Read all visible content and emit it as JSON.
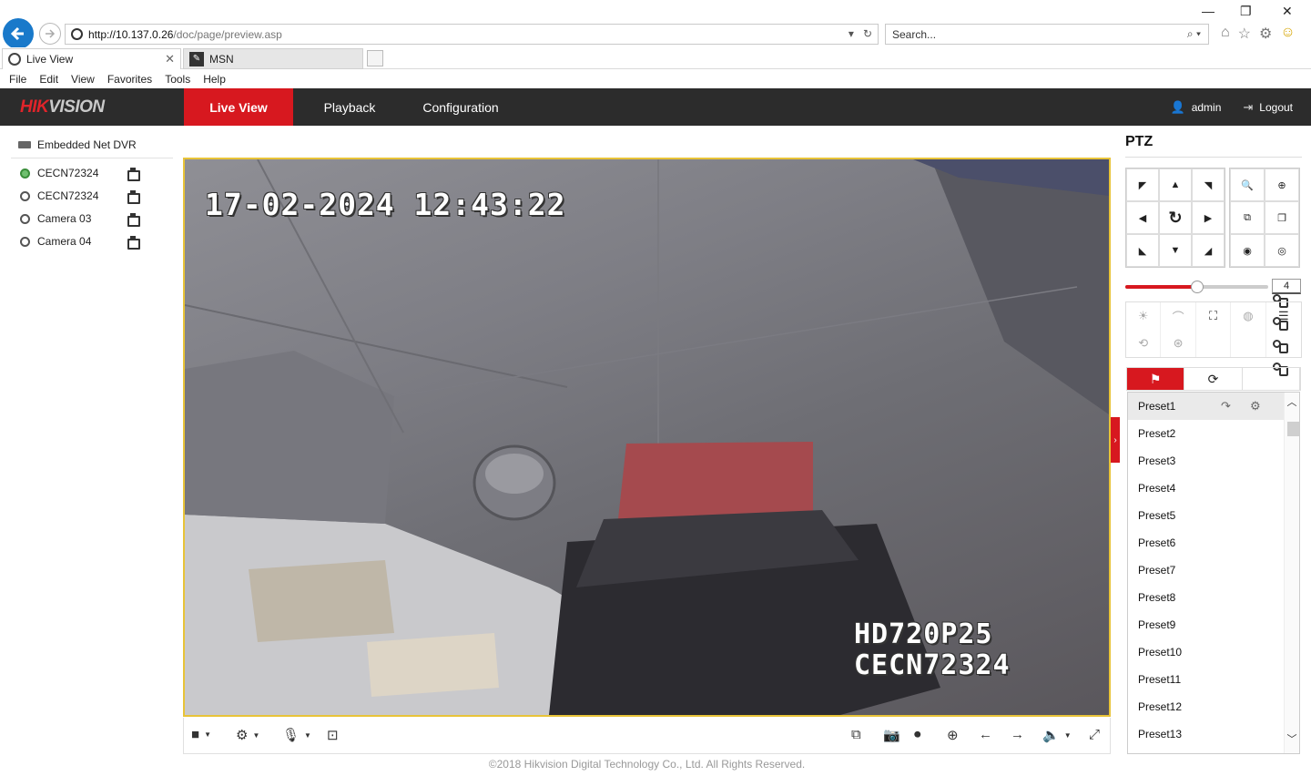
{
  "browser": {
    "url_host": "http://10.137.0.26",
    "url_path": "/doc/page/preview.asp",
    "search_placeholder": "Search...",
    "tabs": [
      {
        "label": "Live View",
        "active": true
      },
      {
        "label": "MSN",
        "active": false
      }
    ],
    "menu": [
      "File",
      "Edit",
      "View",
      "Favorites",
      "Tools",
      "Help"
    ]
  },
  "app": {
    "logo_red": "HIK",
    "logo_grey": "VISION",
    "nav": [
      "Live View",
      "Playback",
      "Configuration"
    ],
    "user": "admin",
    "logout": "Logout",
    "accent_color": "#d7181f"
  },
  "tree": {
    "root": "Embedded Net DVR",
    "cameras": [
      {
        "label": "CECN72324",
        "live": true
      },
      {
        "label": "CECN72324",
        "live": false
      },
      {
        "label": "Camera 03",
        "live": false
      },
      {
        "label": "Camera 04",
        "live": false
      }
    ]
  },
  "video": {
    "timestamp": "17-02-2024  12:43:22",
    "osd_line1": "HD720P25",
    "osd_line2": "CECN72324"
  },
  "ptz": {
    "title": "PTZ",
    "speed": "4",
    "speed_fraction": 0.5,
    "presets": [
      "Preset1",
      "Preset2",
      "Preset3",
      "Preset4",
      "Preset5",
      "Preset6",
      "Preset7",
      "Preset8",
      "Preset9",
      "Preset10",
      "Preset11",
      "Preset12",
      "Preset13"
    ]
  },
  "footer": "©2018 Hikvision Digital Technology Co., Ltd. All Rights Reserved."
}
